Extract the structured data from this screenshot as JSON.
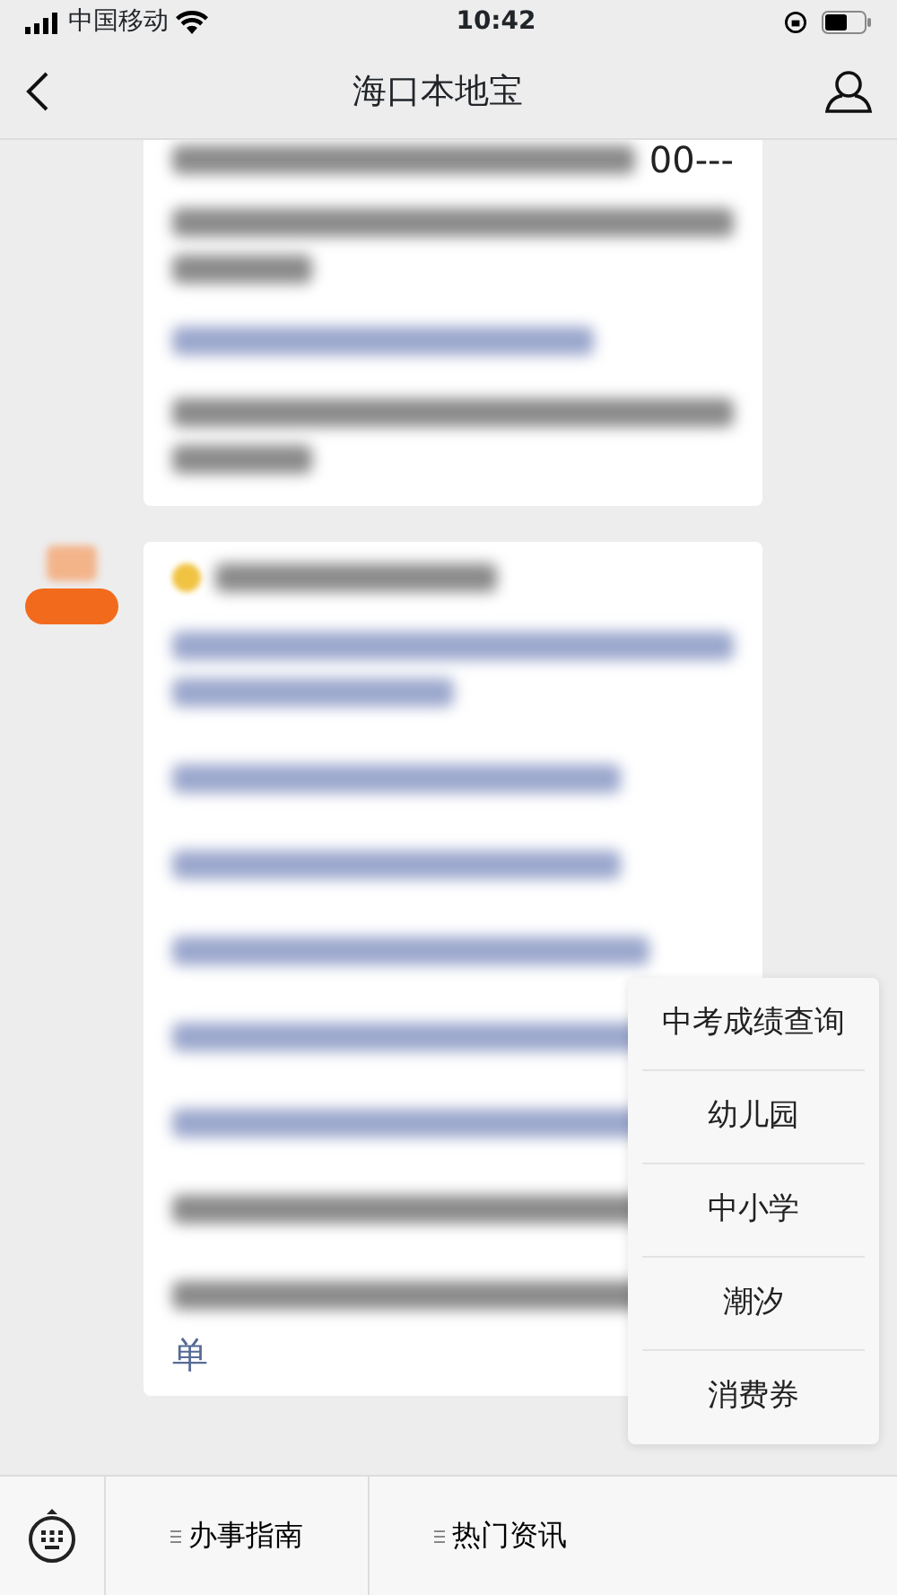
{
  "status_bar": {
    "carrier": "中国移动",
    "time": "10:42"
  },
  "nav_bar": {
    "title": "海口本地宝"
  },
  "messages": [
    {
      "visible_text": "00---"
    },
    {
      "visible_text": "单"
    }
  ],
  "popup_menu": [
    "中考成绩查询",
    "幼儿园",
    "中小学",
    "潮汐",
    "消费券"
  ],
  "bottom_menu": [
    "办事指南",
    "热门资讯"
  ]
}
